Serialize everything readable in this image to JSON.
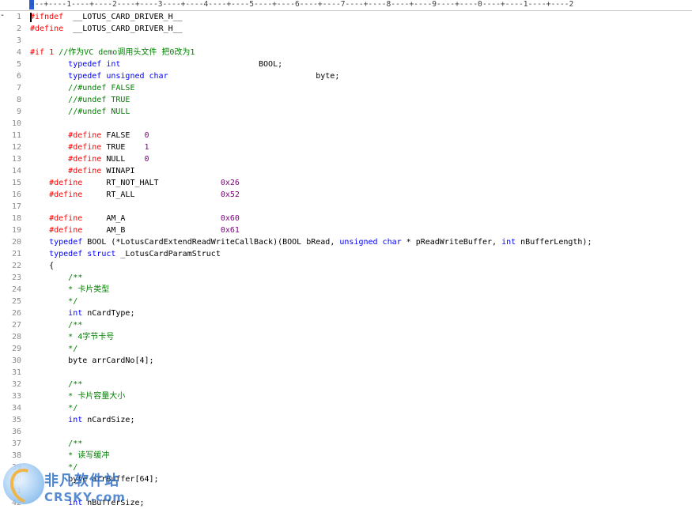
{
  "ruler": {
    "text": "---+----1----+----2----+----3----+----4----+----5----+----6----+----7----+----8----+----9----+----0----+----1----+----2"
  },
  "gutter_marker": "-",
  "lines": [
    {
      "n": "1",
      "seg": [
        [
          "pp",
          "#ifndef"
        ],
        [
          "",
          "  __LOTUS_CARD_DRIVER_H__"
        ]
      ]
    },
    {
      "n": "2",
      "seg": [
        [
          "pp",
          "#define"
        ],
        [
          "",
          "  __LOTUS_CARD_DRIVER_H__"
        ]
      ]
    },
    {
      "n": "3",
      "seg": []
    },
    {
      "n": "4",
      "seg": [
        [
          "pp",
          "#if 1"
        ],
        [
          "cm",
          " //作为VC demo调用头文件 把0改为1"
        ]
      ]
    },
    {
      "n": "5",
      "seg": [
        [
          "",
          "        "
        ],
        [
          "kw",
          "typedef int"
        ],
        [
          "",
          "                             BOOL;"
        ]
      ]
    },
    {
      "n": "6",
      "seg": [
        [
          "",
          "        "
        ],
        [
          "kw",
          "typedef unsigned char"
        ],
        [
          "",
          "                               byte;"
        ]
      ]
    },
    {
      "n": "7",
      "seg": [
        [
          "",
          "        "
        ],
        [
          "cm",
          "//#undef FALSE"
        ]
      ]
    },
    {
      "n": "8",
      "seg": [
        [
          "",
          "        "
        ],
        [
          "cm",
          "//#undef TRUE"
        ]
      ]
    },
    {
      "n": "9",
      "seg": [
        [
          "",
          "        "
        ],
        [
          "cm",
          "//#undef NULL"
        ]
      ]
    },
    {
      "n": "10",
      "seg": []
    },
    {
      "n": "11",
      "seg": [
        [
          "",
          "        "
        ],
        [
          "pp",
          "#define"
        ],
        [
          "",
          " FALSE   "
        ],
        [
          "num",
          "0"
        ]
      ]
    },
    {
      "n": "12",
      "seg": [
        [
          "",
          "        "
        ],
        [
          "pp",
          "#define"
        ],
        [
          "",
          " TRUE    "
        ],
        [
          "num",
          "1"
        ]
      ]
    },
    {
      "n": "13",
      "seg": [
        [
          "",
          "        "
        ],
        [
          "pp",
          "#define"
        ],
        [
          "",
          " NULL    "
        ],
        [
          "num",
          "0"
        ]
      ]
    },
    {
      "n": "14",
      "seg": [
        [
          "",
          "        "
        ],
        [
          "pp",
          "#define"
        ],
        [
          "",
          " WINAPI"
        ]
      ]
    },
    {
      "n": "15",
      "seg": [
        [
          "",
          "    "
        ],
        [
          "pp",
          "#define"
        ],
        [
          "",
          "     RT_NOT_HALT             "
        ],
        [
          "num",
          "0x26"
        ]
      ]
    },
    {
      "n": "16",
      "seg": [
        [
          "",
          "    "
        ],
        [
          "pp",
          "#define"
        ],
        [
          "",
          "     RT_ALL                  "
        ],
        [
          "num",
          "0x52"
        ]
      ]
    },
    {
      "n": "17",
      "seg": []
    },
    {
      "n": "18",
      "seg": [
        [
          "",
          "    "
        ],
        [
          "pp",
          "#define"
        ],
        [
          "",
          "     AM_A                    "
        ],
        [
          "num",
          "0x60"
        ]
      ]
    },
    {
      "n": "19",
      "seg": [
        [
          "",
          "    "
        ],
        [
          "pp",
          "#define"
        ],
        [
          "",
          "     AM_B                    "
        ],
        [
          "num",
          "0x61"
        ]
      ]
    },
    {
      "n": "20",
      "seg": [
        [
          "",
          "    "
        ],
        [
          "kw",
          "typedef"
        ],
        [
          "",
          " BOOL (*LotusCardExtendReadWriteCallBack)(BOOL bRead, "
        ],
        [
          "kw",
          "unsigned char"
        ],
        [
          "",
          " * pReadWriteBuffer, "
        ],
        [
          "kw",
          "int"
        ],
        [
          "",
          " nBufferLength);"
        ]
      ]
    },
    {
      "n": "21",
      "seg": [
        [
          "",
          "    "
        ],
        [
          "kw",
          "typedef struct"
        ],
        [
          "",
          " _LotusCardParamStruct"
        ]
      ]
    },
    {
      "n": "22",
      "seg": [
        [
          "",
          "    {"
        ]
      ]
    },
    {
      "n": "23",
      "seg": [
        [
          "",
          "        "
        ],
        [
          "cm",
          "/**"
        ]
      ]
    },
    {
      "n": "24",
      "seg": [
        [
          "",
          "        "
        ],
        [
          "cm",
          "* 卡片类型"
        ]
      ]
    },
    {
      "n": "25",
      "seg": [
        [
          "",
          "        "
        ],
        [
          "cm",
          "*/"
        ]
      ]
    },
    {
      "n": "26",
      "seg": [
        [
          "",
          "        "
        ],
        [
          "kw",
          "int"
        ],
        [
          "",
          " nCardType;"
        ]
      ]
    },
    {
      "n": "27",
      "seg": [
        [
          "",
          "        "
        ],
        [
          "cm",
          "/**"
        ]
      ]
    },
    {
      "n": "28",
      "seg": [
        [
          "",
          "        "
        ],
        [
          "cm",
          "* 4字节卡号"
        ]
      ]
    },
    {
      "n": "29",
      "seg": [
        [
          "",
          "        "
        ],
        [
          "cm",
          "*/"
        ]
      ]
    },
    {
      "n": "30",
      "seg": [
        [
          "",
          "        byte arrCardNo[4];"
        ]
      ]
    },
    {
      "n": "31",
      "seg": []
    },
    {
      "n": "32",
      "seg": [
        [
          "",
          "        "
        ],
        [
          "cm",
          "/**"
        ]
      ]
    },
    {
      "n": "33",
      "seg": [
        [
          "",
          "        "
        ],
        [
          "cm",
          "* 卡片容量大小"
        ]
      ]
    },
    {
      "n": "34",
      "seg": [
        [
          "",
          "        "
        ],
        [
          "cm",
          "*/"
        ]
      ]
    },
    {
      "n": "35",
      "seg": [
        [
          "",
          "        "
        ],
        [
          "kw",
          "int"
        ],
        [
          "",
          " nCardSize;"
        ]
      ]
    },
    {
      "n": "36",
      "seg": []
    },
    {
      "n": "37",
      "seg": [
        [
          "",
          "        "
        ],
        [
          "cm",
          "/**"
        ]
      ]
    },
    {
      "n": "38",
      "seg": [
        [
          "",
          "        "
        ],
        [
          "cm",
          "* 读写缓冲"
        ]
      ]
    },
    {
      "n": "39",
      "seg": [
        [
          "",
          "        "
        ],
        [
          "cm",
          "*/"
        ]
      ]
    },
    {
      "n": "40",
      "seg": [
        [
          "",
          "        byte arrBuffer[64];"
        ]
      ]
    },
    {
      "n": "41",
      "seg": []
    },
    {
      "n": "42",
      "seg": [
        [
          "",
          "        "
        ],
        [
          "kw",
          "int"
        ],
        [
          "",
          " nBufferSize;"
        ]
      ]
    }
  ],
  "watermark": {
    "title": "非凡软件站",
    "subtitle": "CRSKY.com"
  }
}
